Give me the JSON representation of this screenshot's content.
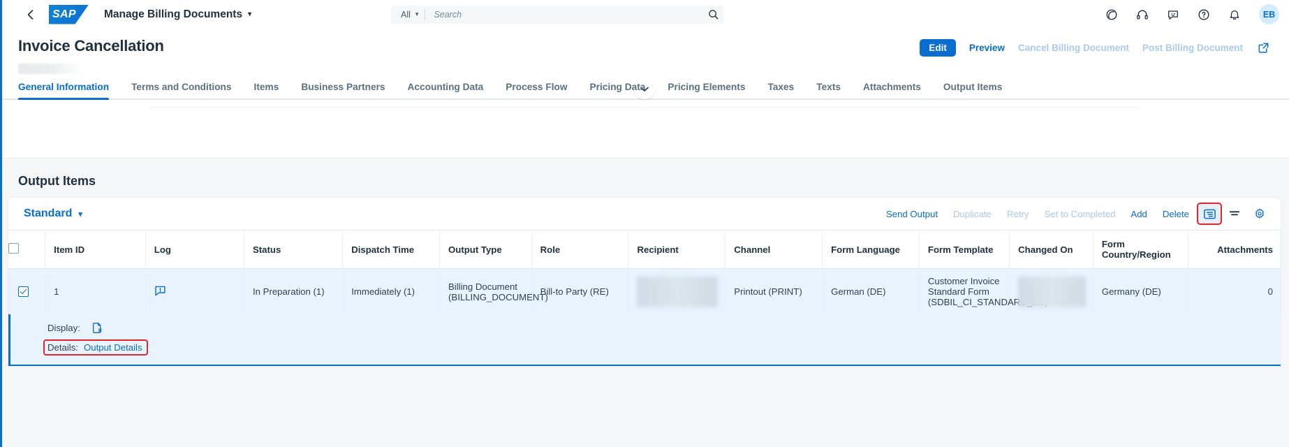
{
  "shell": {
    "back_icon": "chevron-left-icon",
    "logo_text": "SAP",
    "app_title": "Manage Billing Documents",
    "search": {
      "scope": "All",
      "placeholder": "Search",
      "value": ""
    },
    "icons": [
      "copilot-icon",
      "headset-icon",
      "feedback-icon",
      "help-icon",
      "notifications-icon"
    ],
    "avatar_initials": "EB"
  },
  "object_header": {
    "title": "Invoice Cancellation",
    "actions": {
      "edit": "Edit",
      "preview": "Preview",
      "cancel_billing_document": "Cancel Billing Document",
      "post_billing_document": "Post Billing Document",
      "share_icon": "share-icon"
    }
  },
  "tabs": [
    {
      "label": "General Information",
      "active": true
    },
    {
      "label": "Terms and Conditions",
      "active": false
    },
    {
      "label": "Items",
      "active": false
    },
    {
      "label": "Business Partners",
      "active": false
    },
    {
      "label": "Accounting Data",
      "active": false
    },
    {
      "label": "Process Flow",
      "active": false
    },
    {
      "label": "Pricing Data",
      "active": false
    },
    {
      "label": "Pricing Elements",
      "active": false
    },
    {
      "label": "Taxes",
      "active": false
    },
    {
      "label": "Texts",
      "active": false
    },
    {
      "label": "Attachments",
      "active": false
    },
    {
      "label": "Output Items",
      "active": false
    }
  ],
  "section": {
    "title": "Output Items"
  },
  "table_toolbar": {
    "variant": "Standard",
    "send_output": "Send Output",
    "duplicate": "Duplicate",
    "retry": "Retry",
    "set_to_completed": "Set to Completed",
    "add": "Add",
    "delete": "Delete",
    "view_settings_icon": "list-view-icon",
    "sort_icon": "sort-icon",
    "settings_icon": "gear-icon"
  },
  "table": {
    "columns": [
      "Item ID",
      "Log",
      "Status",
      "Dispatch Time",
      "Output Type",
      "Role",
      "Recipient",
      "Channel",
      "Form Language",
      "Form Template",
      "Changed On",
      "Form Country/Region",
      "Attachments"
    ],
    "rows": [
      {
        "selected": true,
        "item_id": "1",
        "log_icon": "log-message-icon",
        "status": "In Preparation (1)",
        "dispatch_time": "Immediately (1)",
        "output_type": "Billing Document (BILLING_DOCUMENT)",
        "role": "Bill-to Party (RE)",
        "recipient": "",
        "channel": "Printout (PRINT)",
        "form_language": "German (DE)",
        "form_template": "Customer Invoice Standard Form (SDBIL_CI_STANDARD_DE)",
        "changed_on": "",
        "form_country_region": "Germany (DE)",
        "attachments": "0"
      }
    ],
    "row_detail": {
      "display_label": "Display:",
      "display_icon": "display-form-icon",
      "details_label": "Details:",
      "details_link": "Output Details"
    }
  },
  "colors": {
    "accent": "#0a6ed1",
    "disabled_link": "#a9c9ee",
    "selected_row": "#e9f3fd",
    "highlight": "#e4262c",
    "text": "#22313f"
  }
}
